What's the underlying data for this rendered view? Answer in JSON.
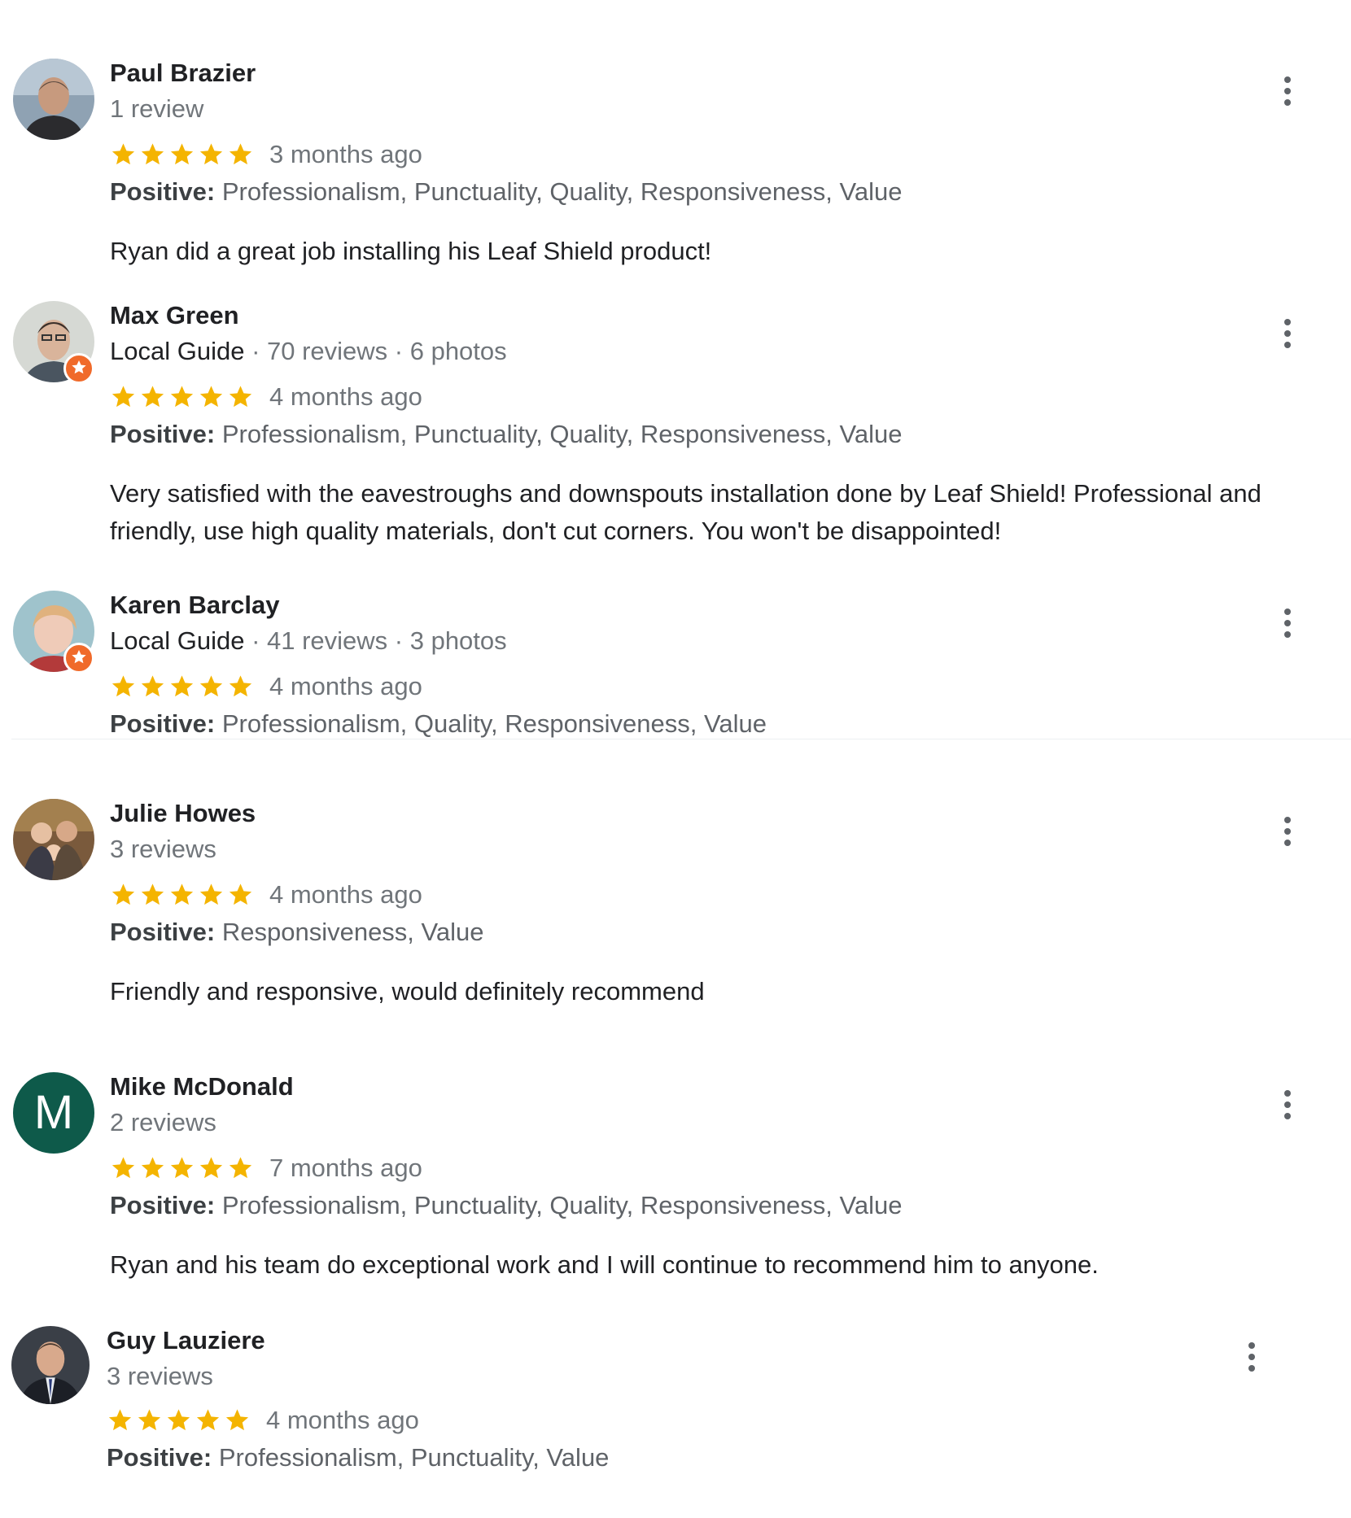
{
  "reviews": [
    {
      "name": "Paul Brazier",
      "meta": "1 review",
      "rating": 5,
      "time": "3 months ago",
      "positive_label": "Positive:",
      "positive": "Professionalism, Punctuality, Quality, Responsiveness, Value",
      "text": "Ryan did a great job installing his Leaf Shield product!"
    },
    {
      "name": "Max Green",
      "meta_guide": "Local Guide",
      "meta_rest": " · 70 reviews · 6 photos",
      "rating": 5,
      "time": "4 months ago",
      "positive_label": "Positive:",
      "positive": "Professionalism, Punctuality, Quality, Responsiveness, Value",
      "text": "Very satisfied with the eavestroughs and downspouts installation done by Leaf Shield! Professional and friendly, use high quality materials, don't cut corners. You won't be disappointed!"
    },
    {
      "name": "Karen Barclay",
      "meta_guide": "Local Guide",
      "meta_rest": " · 41 reviews · 3 photos",
      "rating": 5,
      "time": "4 months ago",
      "positive_label": "Positive:",
      "positive": "Professionalism, Quality, Responsiveness, Value"
    },
    {
      "name": "Julie Howes",
      "meta": "3 reviews",
      "rating": 5,
      "time": "4 months ago",
      "positive_label": "Positive:",
      "positive": "Responsiveness, Value",
      "text": "Friendly and responsive, would definitely recommend"
    },
    {
      "name": "Mike McDonald",
      "avatar_letter": "M",
      "meta": "2 reviews",
      "rating": 5,
      "time": "7 months ago",
      "positive_label": "Positive:",
      "positive": "Professionalism, Punctuality, Quality, Responsiveness, Value",
      "text": "Ryan and his team do exceptional work and I will continue to recommend him to anyone."
    },
    {
      "name": "Guy Lauziere",
      "meta": "3 reviews",
      "rating": 5,
      "time": "4 months ago",
      "positive_label": "Positive:",
      "positive": "Professionalism, Punctuality, Value"
    }
  ],
  "colors": {
    "star": "#f4b400",
    "guide_badge": "#f06a2a",
    "letter_avatar": "#0e5a4a",
    "secondary_text": "#70757a"
  },
  "icons": {
    "star": "star-icon",
    "menu": "more-vert-icon",
    "badge": "local-guide-badge-icon"
  }
}
